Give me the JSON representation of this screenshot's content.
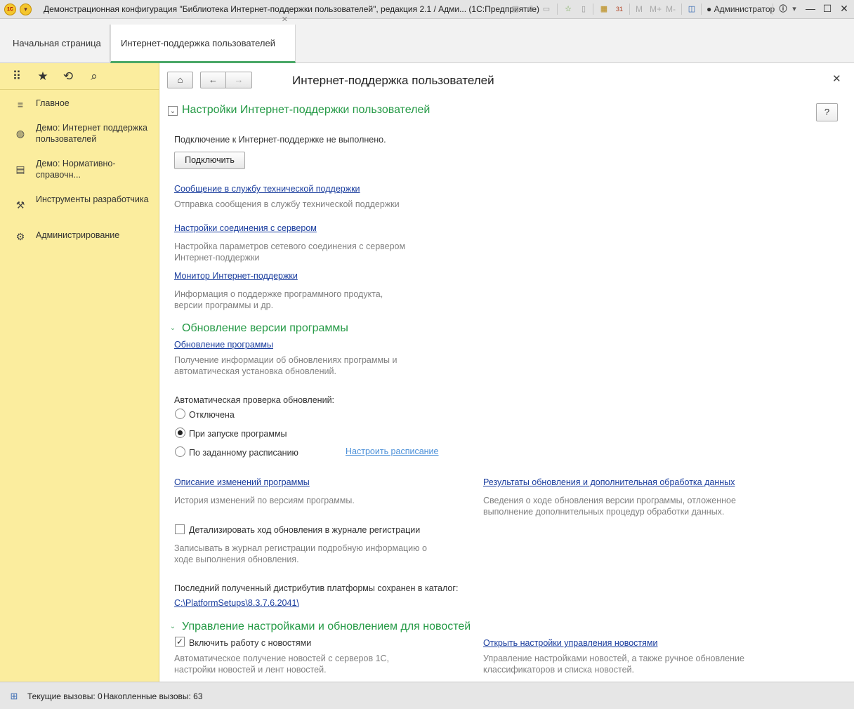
{
  "window": {
    "title": "Демонстрационная конфигурация \"Библиотека Интернет-поддержки пользователей\", редакция 2.1 / Адми...  (1С:Предприятие)",
    "user": "Администратор",
    "m_buttons": [
      "M",
      "M+",
      "M-"
    ]
  },
  "tabs": {
    "home": "Начальная страница",
    "active": "Интернет-поддержка пользователей"
  },
  "sidebar": {
    "items": [
      {
        "label": "Главное"
      },
      {
        "label": "Демо: Интернет поддержка пользователей"
      },
      {
        "label": "Демо: Нормативно-справочн..."
      },
      {
        "label": "Инструменты разработчика"
      },
      {
        "label": "Администрирование"
      }
    ]
  },
  "form": {
    "title": "Интернет-поддержка пользователей",
    "help_label": "?",
    "settings": {
      "title": "Настройки Интернет-поддержки пользователей",
      "status": "Подключение к Интернет-поддержке не выполнено.",
      "connect_button": "Подключить",
      "support_link": "Сообщение в службу технической поддержки",
      "support_desc": "Отправка сообщения в службу технической поддержки",
      "server_link": "Настройки соединения с сервером",
      "server_desc": "Настройка параметров сетевого соединения с сервером Интернет-поддержки",
      "monitor_link": "Монитор Интернет-поддержки",
      "monitor_desc": "Информация о поддержке программного продукта, версии программы и др."
    },
    "update": {
      "title": "Обновление версии программы",
      "update_link": "Обновление программы",
      "update_desc": "Получение информации об обновлениях программы и автоматическая установка обновлений.",
      "auto_check_label": "Автоматическая проверка обновлений:",
      "radio_off": "Отключена",
      "radio_startup": "При запуске программы",
      "radio_schedule": "По заданному расписанию",
      "selected": "При запуске программы",
      "schedule_link": "Настроить расписание",
      "changes_link": "Описание изменений программы",
      "changes_desc": "История изменений по версиям программы.",
      "results_link": "Результаты обновления и дополнительная обработка данных",
      "results_desc": "Сведения о ходе обновления версии программы, отложенное выполнение дополнительных процедур обработки данных.",
      "detail_checkbox": "Детализировать ход обновления в журнале регистрации",
      "detail_checked": false,
      "detail_desc": "Записывать в журнал регистрации подробную информацию о ходе выполнения обновления.",
      "distr_label": "Последний полученный дистрибутив платформы сохранен в каталог:",
      "distr_path": "C:\\PlatformSetups\\8.3.7.6.2041\\"
    },
    "news": {
      "title": "Управление настройками и обновлением для новостей",
      "enable_checkbox": "Включить работу с новостями",
      "enable_checked": true,
      "enable_desc": "Автоматическое получение новостей с серверов 1С, настройки новостей и лент новостей.",
      "settings_link": "Открыть настройки управления новостями",
      "settings_desc": "Управление настройками новостей, а также ручное обновление классификаторов и списка новостей."
    }
  },
  "status": {
    "current_calls": "Текущие вызовы: 0",
    "accumulated_calls": "Накопленные вызовы: 63"
  },
  "colors": {
    "accent_green": "#259a46",
    "link_blue": "#1a3d9e",
    "sidebar_yellow": "#fbed9e"
  }
}
